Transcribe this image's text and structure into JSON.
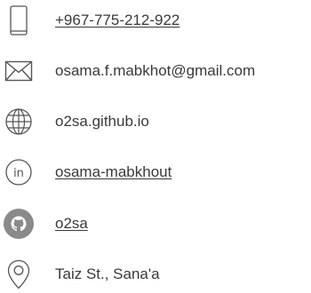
{
  "contacts": {
    "phone": {
      "text": "+967-775-212-922",
      "icon": "phone-icon"
    },
    "email": {
      "text": "osama.f.mabkhot@gmail.com",
      "icon": "envelope-icon"
    },
    "website": {
      "text": "o2sa.github.io",
      "icon": "globe-icon"
    },
    "linkedin": {
      "text": "osama-mabkhout",
      "icon": "linkedin-icon",
      "icon_text": "in"
    },
    "github": {
      "text": "o2sa",
      "icon": "github-icon"
    },
    "location": {
      "text": "Taiz St., Sana'a",
      "icon": "location-pin-icon"
    }
  },
  "colors": {
    "text": "#3a3a3a",
    "icon_stroke": "#555555",
    "github_badge": "#8a8a8a"
  }
}
